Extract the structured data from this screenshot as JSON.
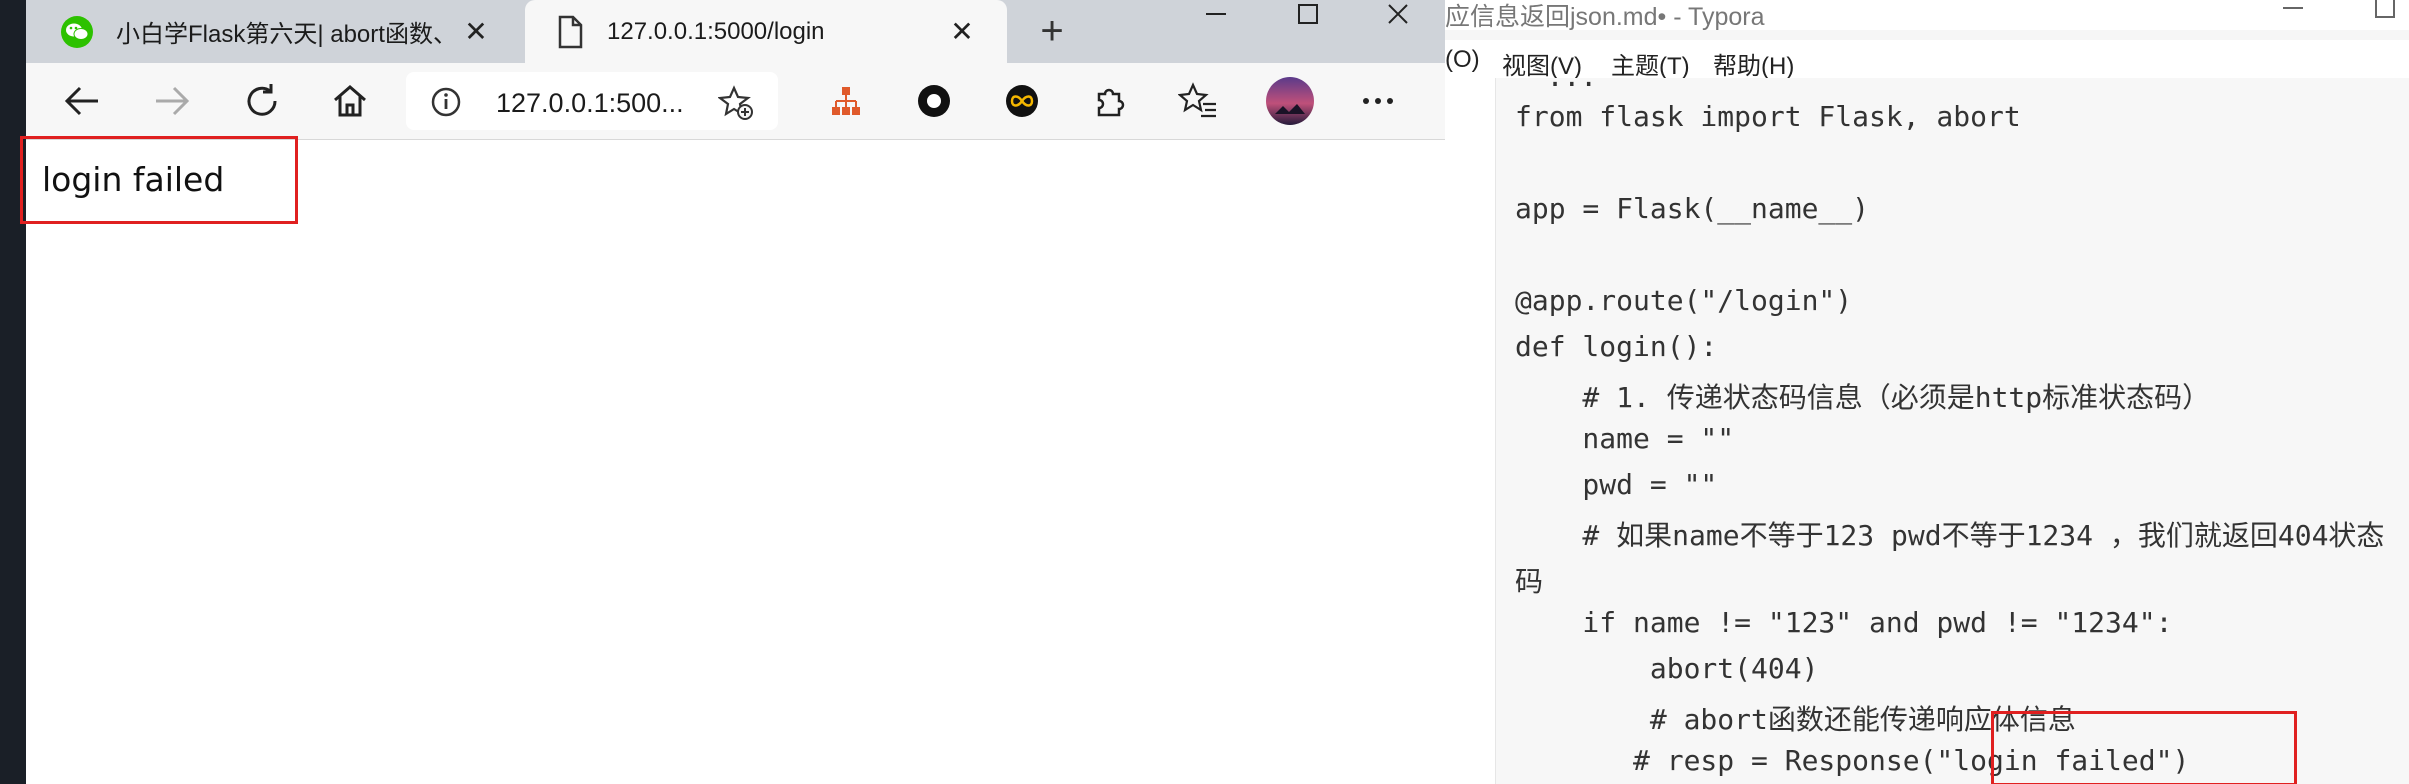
{
  "browser": {
    "tabs": [
      {
        "title": "小白学Flask第六天| abort函数、",
        "close": "✕",
        "icon": "wechat-icon"
      },
      {
        "title": "127.0.0.1:5000/login",
        "close": "✕",
        "icon": "page-icon"
      }
    ],
    "new_tab": "+",
    "address": "127.0.0.1:500...",
    "page_text": "login failed"
  },
  "typora": {
    "title": "应信息返回json.md• - Typora",
    "menu": [
      "(O)",
      "视图(V)",
      "主题(T)",
      "帮助(H)"
    ],
    "code_lines": [
      "from flask import Flask, abort",
      "app = Flask(__name__)",
      "@app.route(\"/login\")",
      "def login():",
      "    # 1. 传递状态码信息（必须是http标准状态码）",
      "    name = \"\"",
      "    pwd = \"\"",
      "    # 如果name不等于123 pwd不等于1234 ，我们就返回404状态",
      "码",
      "    if name != \"123\" and pwd != \"1234\":",
      "        abort(404)",
      "        # abort函数还能传递响应体信息",
      "       # resp = Response(\"login failed\")"
    ]
  },
  "colors": {
    "highlight_box": "#e02020",
    "tabbar_bg": "#cfd3d9",
    "wechat_green": "#2dc100"
  }
}
